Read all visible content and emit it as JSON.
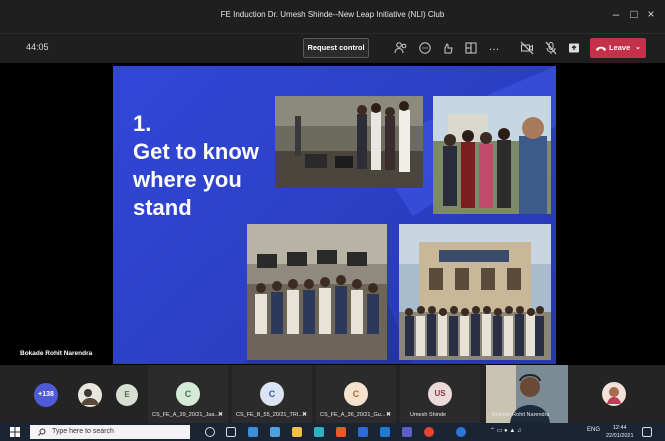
{
  "window": {
    "title": "FE Induction Dr. Umesh Shinde--New Leap Initiative (NLI) Club"
  },
  "toolbar": {
    "timer": "44:05",
    "request_control": "Request control",
    "more": "…",
    "leave": "Leave"
  },
  "slide": {
    "heading": "1.\nGet to know\nwhere you\nstand"
  },
  "presenter": {
    "name": "Bokade Rohit Narendra"
  },
  "participants": {
    "overflow_count": "+138",
    "tiles": [
      {
        "initial": "E",
        "label": ""
      },
      {
        "initial": "C",
        "label": "CS_FE_A_39_20/21_Jaa..."
      },
      {
        "initial": "C",
        "label": "CS_FE_B_55_20/21_TRI..."
      },
      {
        "initial": "C",
        "label": "CS_FE_A_36_20/21_Gu..."
      },
      {
        "initial": "US",
        "label": "Umesh Shinde"
      },
      {
        "initial": "",
        "label": "Bokade Rohit Narendra"
      }
    ]
  },
  "taskbar": {
    "search_placeholder": "Type here to search",
    "lang": "ENG",
    "time": "12:44",
    "date": "22/01/2021"
  },
  "colors": {
    "leave": "#c4314b",
    "slide_bg": "#2b3fc4",
    "titlebar": "#1f1f1f"
  }
}
